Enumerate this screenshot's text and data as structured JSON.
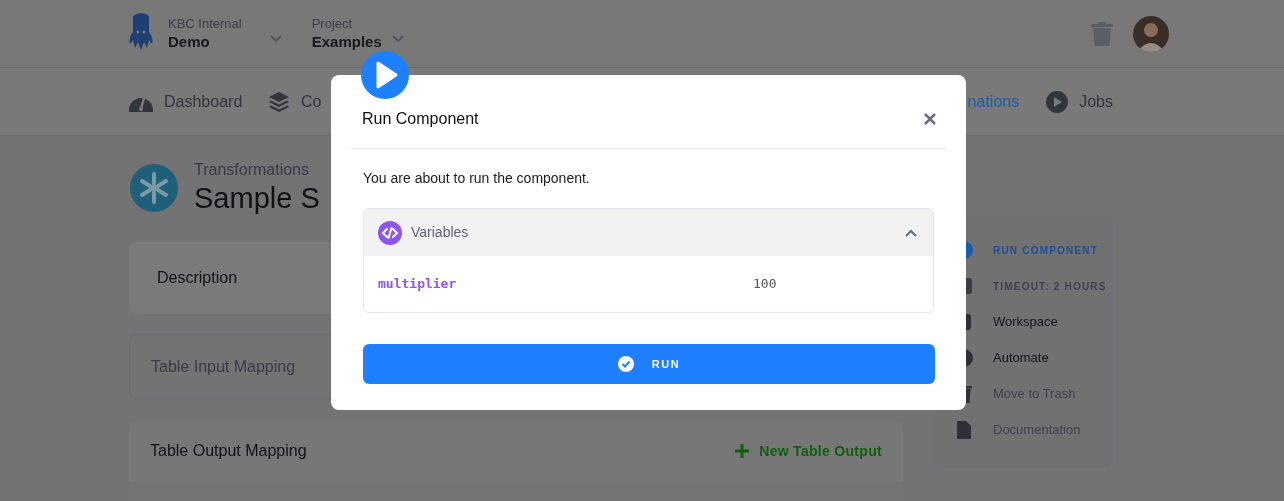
{
  "header": {
    "organization_label": "KBC Internal",
    "organization": "Demo",
    "project_label": "Project",
    "project": "Examples"
  },
  "nav": [
    {
      "label": "Dashboard",
      "selected": false
    },
    {
      "label": "Co",
      "selected": false
    },
    {
      "label": "nations",
      "selected": true
    },
    {
      "label": "Jobs",
      "selected": false
    }
  ],
  "page": {
    "breadcrumb": "Transformations",
    "title": "Sample S"
  },
  "cards": [
    {
      "title": "Description",
      "kind": "plain"
    },
    {
      "title": "Table Input Mapping",
      "kind": "muted"
    },
    {
      "title": "Table Output Mapping",
      "kind": "action",
      "action": "New Table Output"
    }
  ],
  "sidebar": [
    {
      "label": "RUN COMPONENT",
      "kind": "caps",
      "selected": true
    },
    {
      "label": "TIMEOUT: 2 HOURS",
      "kind": "caps",
      "selected": false
    },
    {
      "label": "Workspace",
      "kind": "item",
      "disabled": false
    },
    {
      "label": "Automate",
      "kind": "item",
      "disabled": false
    },
    {
      "label": "Move to Trash",
      "kind": "item",
      "disabled": true
    },
    {
      "label": "Documentation",
      "kind": "item",
      "disabled": true
    }
  ],
  "dialog": {
    "title": "Run Component",
    "message": "You are about to run the component.",
    "variables": {
      "title": "Variables",
      "expanded": true,
      "rows": [
        {
          "name": "multiplier",
          "value": "100"
        }
      ]
    },
    "button": "RUN"
  }
}
